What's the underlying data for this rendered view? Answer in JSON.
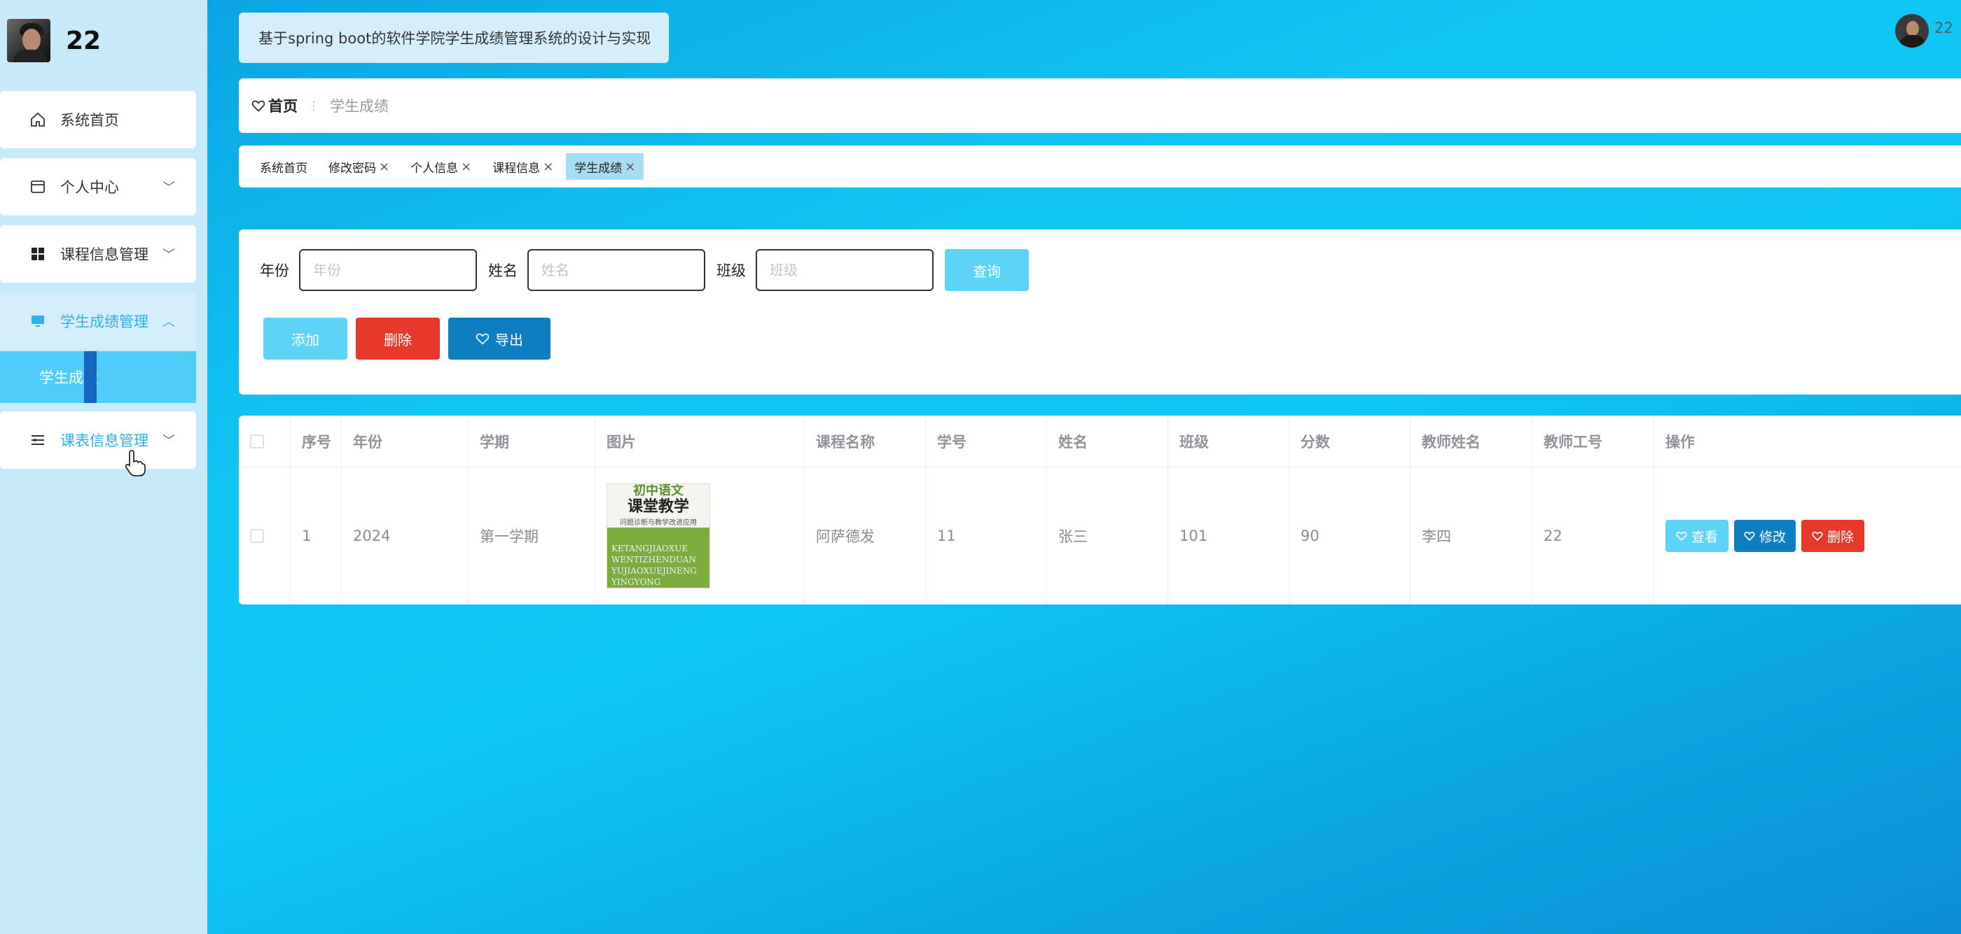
{
  "sidebar": {
    "username": "22",
    "items": [
      {
        "label": "系统首页",
        "icon": "home-icon"
      },
      {
        "label": "个人中心",
        "icon": "card-icon"
      },
      {
        "label": "课程信息管理",
        "icon": "grid-icon"
      },
      {
        "label": "学生成绩管理",
        "icon": "monitor-icon"
      },
      {
        "label": "课表信息管理",
        "icon": "list-icon"
      }
    ],
    "sub_item": "学生成绩"
  },
  "header": {
    "title": "基于spring boot的软件学院学生成绩管理系统的设计与实现",
    "user": "22"
  },
  "breadcrumb": {
    "home": "首页",
    "current": "学生成绩"
  },
  "tags": [
    {
      "label": "系统首页",
      "closable": false
    },
    {
      "label": "修改密码",
      "closable": true
    },
    {
      "label": "个人信息",
      "closable": true
    },
    {
      "label": "课程信息",
      "closable": true
    },
    {
      "label": "学生成绩",
      "closable": true,
      "active": true
    }
  ],
  "search": {
    "year_label": "年份",
    "year_placeholder": "年份",
    "name_label": "姓名",
    "name_placeholder": "姓名",
    "class_label": "班级",
    "class_placeholder": "班级",
    "query_button": "查询"
  },
  "actions": {
    "add": "添加",
    "delete": "删除",
    "export": "导出"
  },
  "table": {
    "headers": [
      "序号",
      "年份",
      "学期",
      "图片",
      "课程名称",
      "学号",
      "姓名",
      "班级",
      "分数",
      "教师姓名",
      "教师工号",
      "操作"
    ],
    "rows": [
      {
        "index": "1",
        "year": "2024",
        "term": "第一学期",
        "image": {
          "line1": "初中语文",
          "line2": "课堂教学",
          "line3": "问题诊断与教学改进应用",
          "line4": "KETANGJIAOXUE WENTIZHENDUAN YUJIAOXUEJINENG YINGYONG"
        },
        "course": "阿萨德发",
        "student_no": "11",
        "name": "张三",
        "class": "101",
        "score": "90",
        "teacher_name": "李四",
        "teacher_no": "22",
        "ops": {
          "view": "查看",
          "edit": "修改",
          "delete": "删除"
        }
      }
    ]
  },
  "colors": {
    "accent": "#5dd3f7",
    "danger": "#e4392b",
    "primary": "#0d7fc0",
    "sidebar_bg": "#c6eaf9"
  }
}
